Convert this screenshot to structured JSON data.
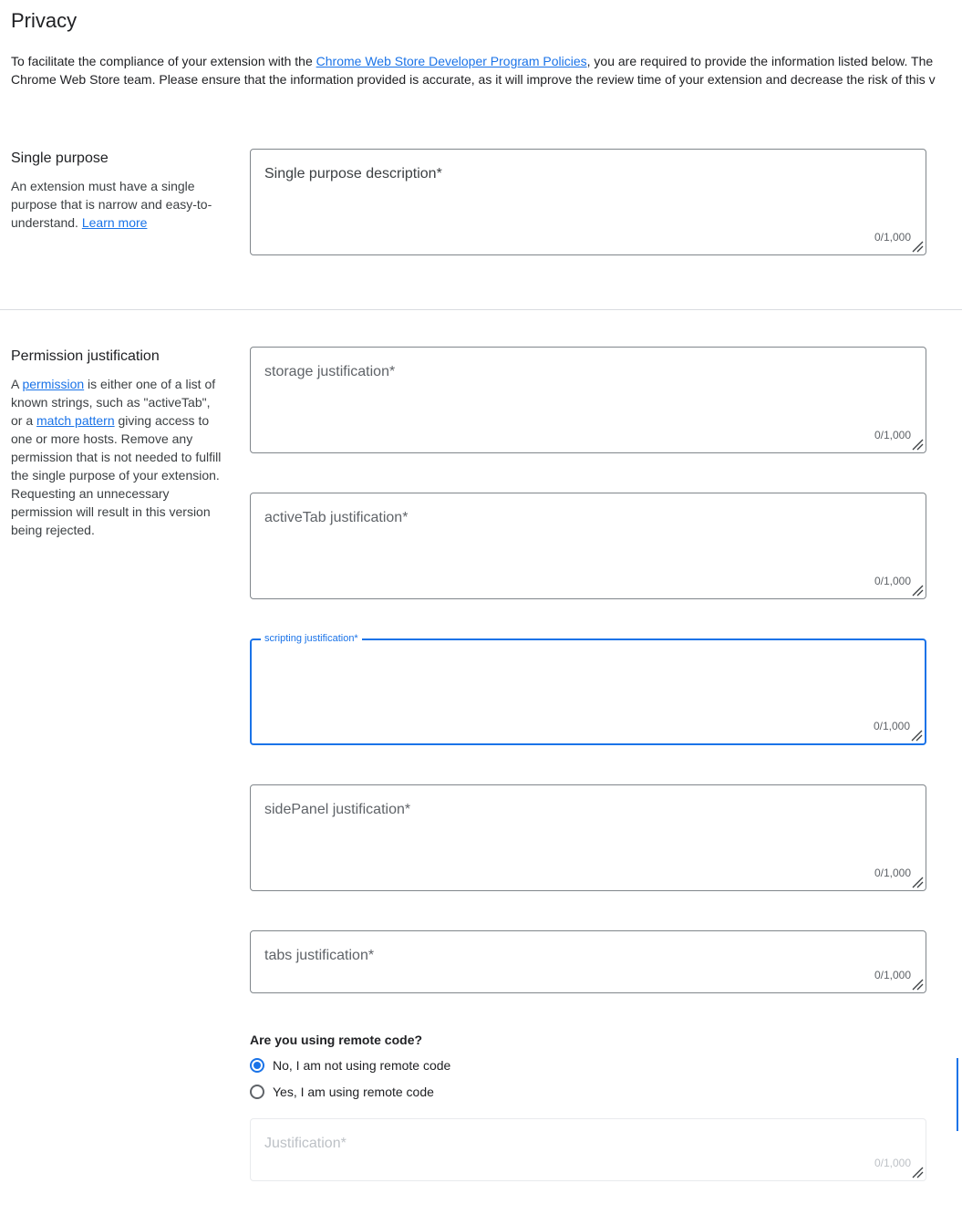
{
  "page": {
    "title": "Privacy",
    "intro": {
      "line1_prefix": "To facilitate the compliance of your extension with the ",
      "line1_link": "Chrome Web Store Developer Program Policies",
      "line1_suffix": ", you are required to provide the information listed below. The",
      "line2": "Chrome Web Store team. Please ensure that the information provided is accurate, as it will improve the review time of your extension and decrease the risk of this v"
    }
  },
  "single_purpose": {
    "heading": "Single purpose",
    "desc_text": "An extension must have a single purpose that is narrow and easy-to-understand. ",
    "desc_link": "Learn more",
    "field": {
      "label": "Single purpose description*",
      "counter": "0/1,000"
    }
  },
  "permissions": {
    "heading": "Permission justification",
    "desc_a": "A ",
    "desc_link1": "permission",
    "desc_b": " is either one of a list of known strings, such as \"activeTab\", or a ",
    "desc_link2": "match pattern",
    "desc_c": " giving access to one or more hosts. Remove any permission that is not needed to fulfill the single purpose of your extension. Requesting an unnecessary permission will result in this version being rejected.",
    "fields": [
      {
        "label": "storage justification*",
        "counter": "0/1,000"
      },
      {
        "label": "activeTab justification*",
        "counter": "0/1,000"
      },
      {
        "label": "scripting justification*",
        "counter": "0/1,000"
      },
      {
        "label": "sidePanel justification*",
        "counter": "0/1,000"
      },
      {
        "label": "tabs justification*",
        "counter": "0/1,000"
      }
    ]
  },
  "remote_code": {
    "question": "Are you using remote code?",
    "options": [
      {
        "label": "No, I am not using remote code",
        "selected": true
      },
      {
        "label": "Yes, I am using remote code",
        "selected": false
      }
    ],
    "justification": {
      "label": "Justification*",
      "counter": "0/1,000"
    }
  },
  "colors": {
    "accent": "#1a73e8",
    "border": "#80868b",
    "text": "#202124"
  }
}
